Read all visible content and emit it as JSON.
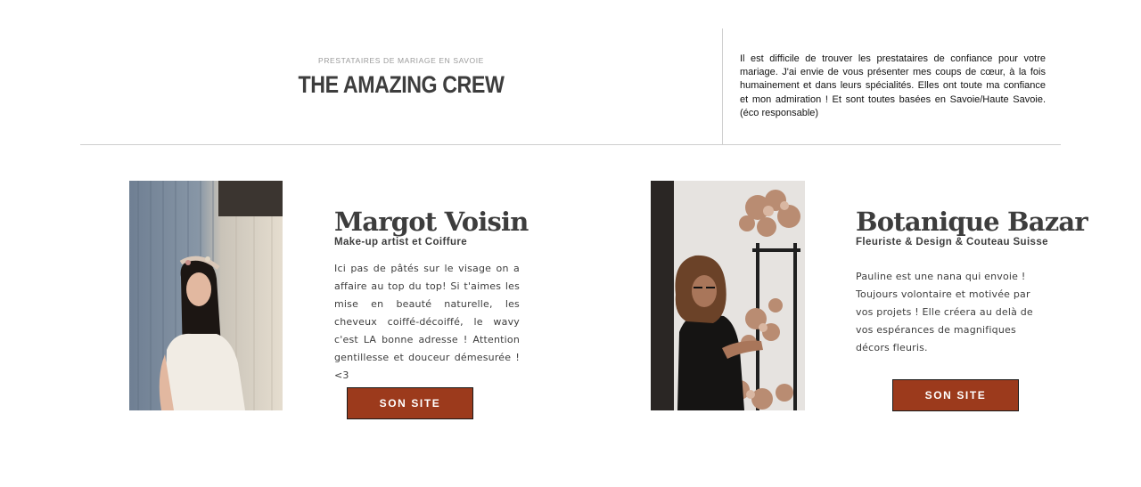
{
  "header": {
    "eyebrow": "PRESTATAIRES DE MARIAGE EN SAVOIE",
    "title": "THE AMAZING CREW",
    "intro": "Il est difficile de trouver les prestataires de confiance pour votre mariage. J'ai envie de vous présenter mes coups de cœur, à la fois humainement et dans leurs spécialités. Elles ont toute ma confiance et mon admiration !  Et sont toutes basées en Savoie/Haute Savoie. (éco responsable)"
  },
  "vendors": [
    {
      "name": "Margot Voisin",
      "role": "Make-up artist et Coiffure",
      "description": "Ici pas de pâtés sur le visage on a affaire au top du top! Si t'aimes les mise en beauté naturelle, les cheveux coiffé-décoiffé, le wavy c'est LA bonne adresse ! Attention gentillesse et douceur démesurée ! <3",
      "button": "SON SITE"
    },
    {
      "name": "Botanique Bazar",
      "role": "Fleuriste & Design & Couteau Suisse",
      "description": "Pauline est une nana qui envoie ! Toujours volontaire et motivée par vos projets ! Elle créera au delà de vos espérances de magnifiques décors fleuris.",
      "button": "SON SITE"
    }
  ],
  "colors": {
    "button_bg": "#9c3a1c",
    "divider": "#cfcfcf",
    "text": "#3d3d3d"
  }
}
